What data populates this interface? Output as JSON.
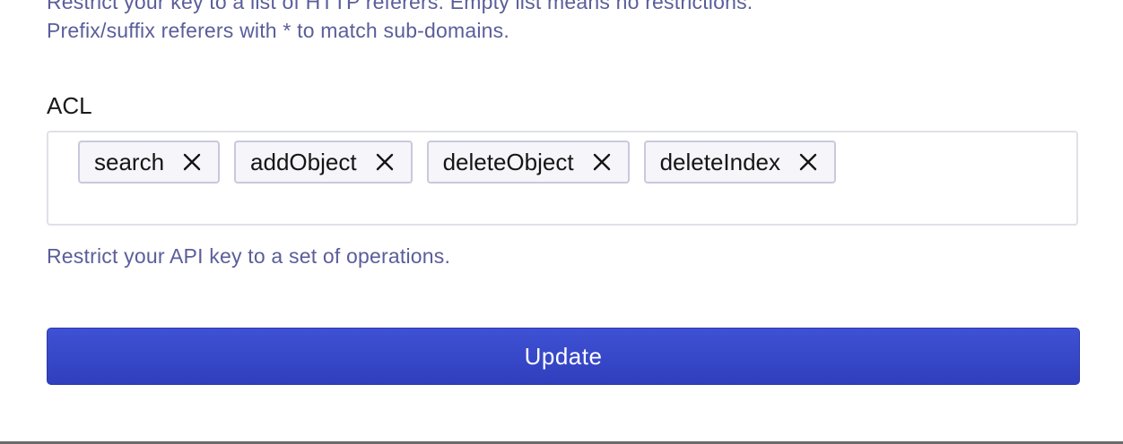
{
  "referers_field": {
    "help_line_1": "Restrict your key to a list of HTTP referers. Empty list means no restrictions.",
    "help_line_2": "Prefix/suffix referers with * to match sub-domains."
  },
  "acl_field": {
    "label": "ACL",
    "tags": [
      {
        "label": "search",
        "remove_icon": "close-icon"
      },
      {
        "label": "addObject",
        "remove_icon": "close-icon"
      },
      {
        "label": "deleteObject",
        "remove_icon": "close-icon"
      },
      {
        "label": "deleteIndex",
        "remove_icon": "close-icon"
      }
    ],
    "help": "Restrict your API key to a set of operations."
  },
  "actions": {
    "update_label": "Update"
  },
  "colors": {
    "help_text": "#5a5e9a",
    "button_primary": "#3a4acb",
    "tag_background": "#f5f5fa",
    "tag_border": "#c8c9dc",
    "input_border": "#e0e0ea"
  }
}
